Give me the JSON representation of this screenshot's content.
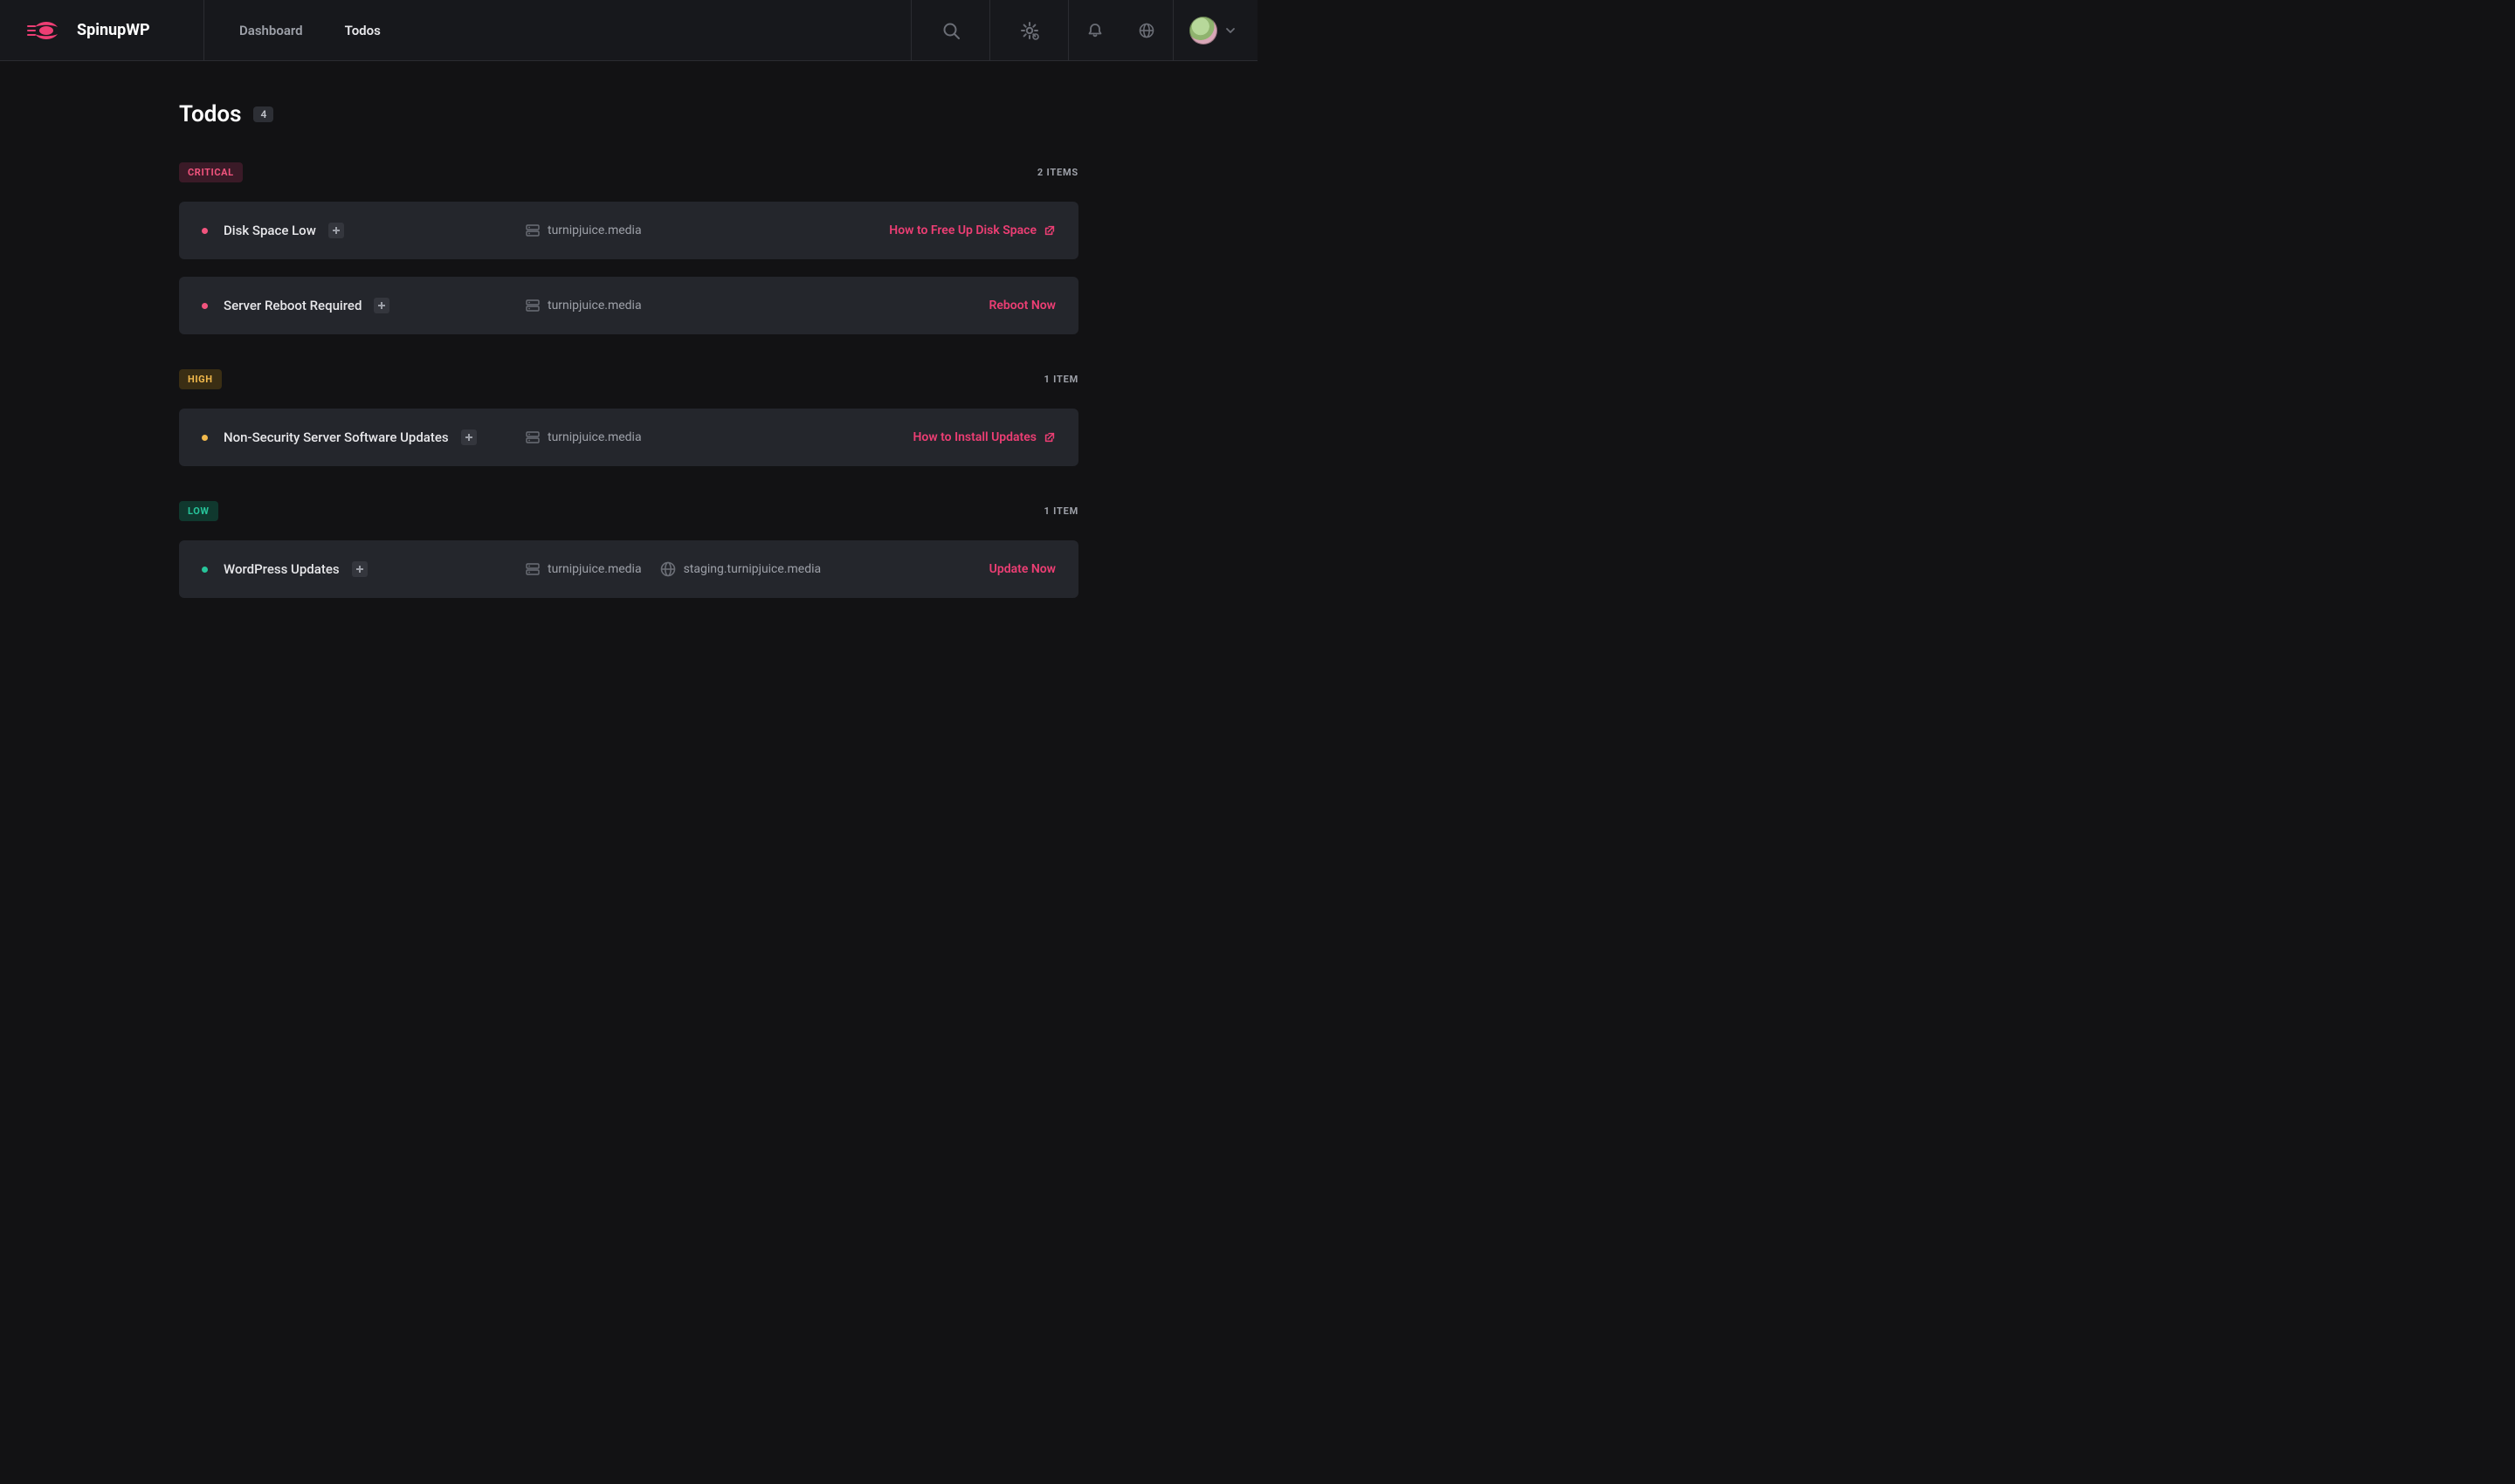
{
  "brand": "SpinupWP",
  "nav": {
    "dashboard": "Dashboard",
    "todos": "Todos"
  },
  "page": {
    "title": "Todos",
    "count": "4"
  },
  "sections": {
    "critical": {
      "label": "CRITICAL",
      "count": "2 ITEMS",
      "items": [
        {
          "title": "Disk Space Low",
          "host1": "turnipjuice.media",
          "action": "How to Free Up Disk Space"
        },
        {
          "title": "Server Reboot Required",
          "host1": "turnipjuice.media",
          "action": "Reboot Now"
        }
      ]
    },
    "high": {
      "label": "HIGH",
      "count": "1 ITEM",
      "items": [
        {
          "title": "Non-Security Server Software Updates",
          "host1": "turnipjuice.media",
          "action": "How to Install Updates"
        }
      ]
    },
    "low": {
      "label": "LOW",
      "count": "1 ITEM",
      "items": [
        {
          "title": "WordPress Updates",
          "host1": "turnipjuice.media",
          "host2": "staging.turnipjuice.media",
          "action": "Update Now"
        }
      ]
    }
  }
}
